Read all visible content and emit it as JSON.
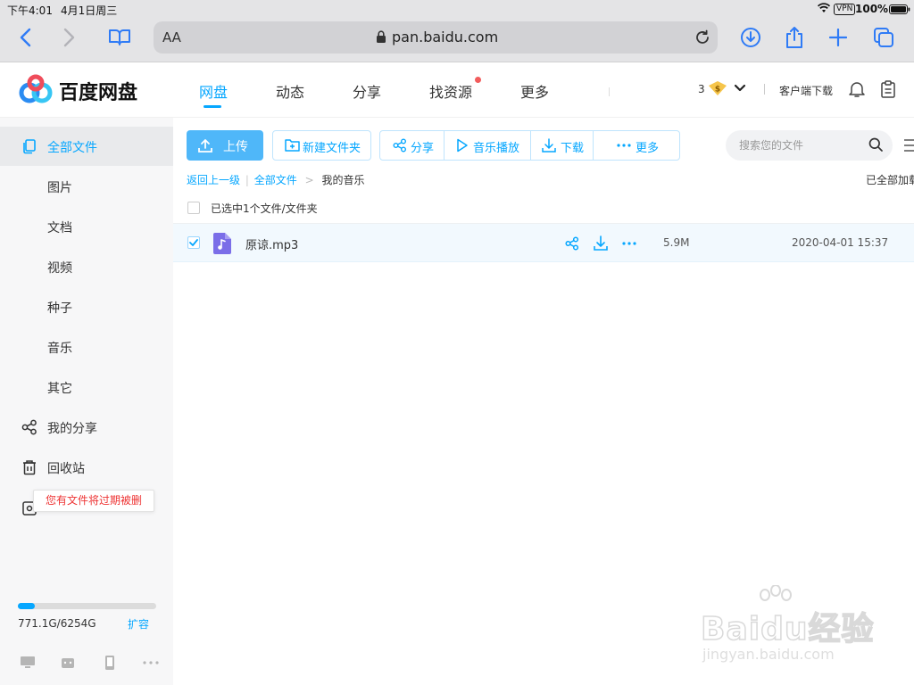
{
  "status": {
    "time": "下午4:01",
    "date": "4月1日周三",
    "vpn": "VPN",
    "battery": "100%"
  },
  "browser": {
    "aa": "AA",
    "url": "pan.baidu.com"
  },
  "site": {
    "logo_text": "百度网盘",
    "nav": [
      "网盘",
      "动态",
      "分享",
      "找资源",
      "更多"
    ],
    "coins": "3",
    "client_download": "客户端下载"
  },
  "sidebar": {
    "items": [
      {
        "label": "全部文件"
      },
      {
        "label": "图片"
      },
      {
        "label": "文档"
      },
      {
        "label": "视频"
      },
      {
        "label": "种子"
      },
      {
        "label": "音乐"
      },
      {
        "label": "其它"
      },
      {
        "label": "我的分享"
      },
      {
        "label": "回收站"
      }
    ],
    "tooltip": "您有文件将过期被删",
    "storage": {
      "used_label": "771.1G/6254G",
      "used_fraction": 0.123,
      "expand": "扩容"
    }
  },
  "toolbar": {
    "upload": "上传",
    "new_folder": "新建文件夹",
    "share": "分享",
    "music_play": "音乐播放",
    "download": "下载",
    "more": "更多",
    "search_placeholder": "搜索您的文件"
  },
  "breadcrumb": {
    "back": "返回上一级",
    "all": "全部文件",
    "current": "我的音乐",
    "loaded": "已全部加载"
  },
  "selection": {
    "label": "已选中1个文件/文件夹"
  },
  "files": [
    {
      "name": "原谅.mp3",
      "size": "5.9M",
      "date": "2020-04-01 15:37",
      "checked": true
    }
  ],
  "watermark": {
    "brand": "Baidu经验",
    "url": "jingyan.baidu.com"
  },
  "colors": {
    "accent": "#06a7ff",
    "upload_bg": "#4fb7f9",
    "selected_row": "#f2f9fe",
    "sidebar_bg": "#f7f7f8",
    "danger": "#e33"
  }
}
